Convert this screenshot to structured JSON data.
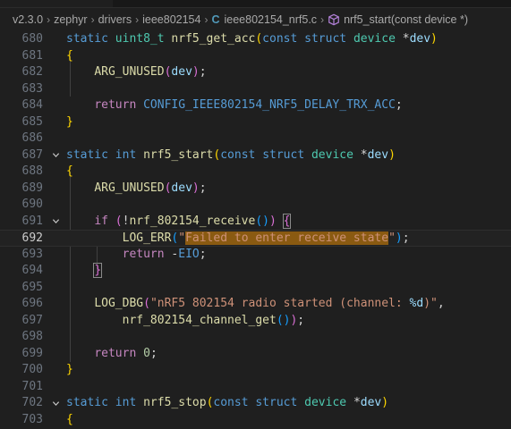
{
  "breadcrumb": {
    "items": [
      "v2.3.0",
      "zephyr",
      "drivers",
      "ieee802154",
      "ieee802154_nrf5.c",
      "nrf5_start(const device *)"
    ],
    "file_icon": "C"
  },
  "editor": {
    "current_line": "692",
    "line_numbers": [
      "680",
      "681",
      "682",
      "683",
      "684",
      "685",
      "686",
      "687",
      "688",
      "689",
      "690",
      "691",
      "692",
      "693",
      "694",
      "695",
      "696",
      "697",
      "698",
      "699",
      "700",
      "701",
      "702",
      "703"
    ],
    "tokens": {
      "static": "static",
      "uint8_t": "uint8_t",
      "int": "int",
      "const": "const",
      "struct": "struct",
      "device": "device",
      "if": "if",
      "return": "return",
      "nrf5_get_acc": "nrf5_get_acc",
      "nrf5_start": "nrf5_start",
      "nrf5_stop": "nrf5_stop",
      "dev": "dev",
      "ARG_UNUSED": "ARG_UNUSED",
      "CONFIG_ACC": "CONFIG_IEEE802154_NRF5_DELAY_TRX_ACC",
      "nrf_receive": "nrf_802154_receive",
      "LOG_ERR": "LOG_ERR",
      "LOG_DBG": "LOG_DBG",
      "EIO": "EIO",
      "channel_get": "nrf_802154_channel_get",
      "zero": "0",
      "err_msg": "Failed to enter receive state",
      "dbg_msg_a": "\"nRF5 802154 radio started (channel: ",
      "dbg_fmt": "%d",
      "dbg_msg_b": "\"",
      "dq": "\""
    }
  }
}
